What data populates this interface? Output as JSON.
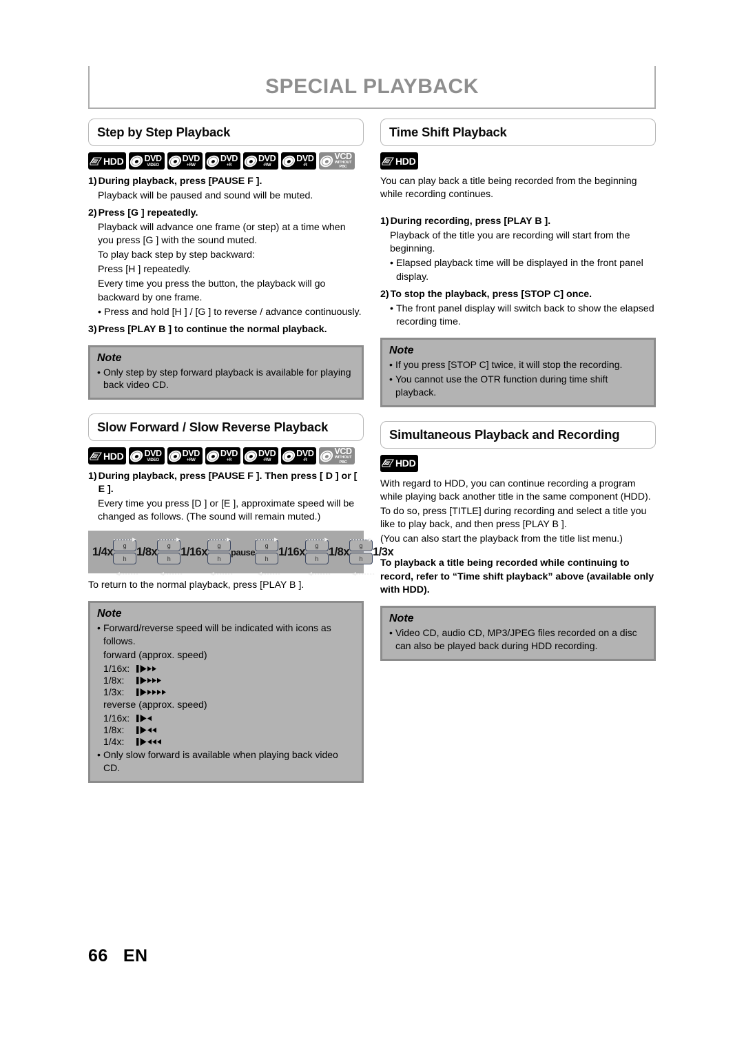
{
  "page": {
    "title": "SPECIAL PLAYBACK",
    "footer_number": "66",
    "footer_lang": "EN",
    "title_color": "#8e8e8e",
    "note_bg_color": "#b3b3b3",
    "note_border_color": "#8c8c8c",
    "diagram_bg_color": "#a8a8a8"
  },
  "icons": {
    "hdd": {
      "main": "HDD"
    },
    "dvd_video": {
      "main": "DVD",
      "sub": "VIDEO"
    },
    "dvd_plus_rw": {
      "main": "DVD",
      "sub": "+RW"
    },
    "dvd_plus_r": {
      "main": "DVD",
      "sub": "+R"
    },
    "dvd_minus_rw": {
      "main": "DVD",
      "sub": "-RW"
    },
    "dvd_minus_r": {
      "main": "DVD",
      "sub": "-R"
    },
    "vcd": {
      "main": "VCD",
      "sub1": "WITHOUT",
      "sub2": "PBC"
    }
  },
  "left": {
    "section1": {
      "heading": "Step by Step Playback",
      "step1": {
        "num": "1)",
        "text": "During playback, press [PAUSE F ]."
      },
      "step1_body": "Playback will be paused and sound will be muted.",
      "step2": {
        "num": "2)",
        "text": "Press [G  ] repeatedly."
      },
      "step2_body1": "Playback will advance one frame (or step) at a time when you press [G  ] with the sound muted.",
      "step2_body2": "To play back step by step backward:",
      "step2_body3": "Press [H  ] repeatedly.",
      "step2_body4": "Every time you press the button, the playback will go backward by one frame.",
      "step2_bullet": "Press and hold [H  ] / [G  ] to reverse / advance continuously.",
      "step3": {
        "num": "3)",
        "text": "Press [PLAY B ] to continue the normal playback."
      },
      "note": {
        "title": "Note",
        "bullets": [
          "Only step by step forward playback is available for playing back video CD."
        ]
      }
    },
    "section2": {
      "heading": "Slow Forward / Slow Reverse Playback",
      "step1": {
        "num": "1)",
        "text": "During playback, press [PAUSE F ]. Then press [ D  ] or [ E  ]."
      },
      "step1_body": "Every time you press [D  ] or [E  ], approximate speed will be changed as follows. (The sound will remain muted.)",
      "diagram": {
        "labels": [
          "1/4x",
          "1/8x",
          "1/16x",
          "pause",
          "1/16x",
          "1/8x",
          "1/3x"
        ],
        "key_top": "g",
        "key_bottom": "h"
      },
      "return_text": "To return to the normal playback, press [PLAY B ].",
      "note": {
        "title": "Note",
        "bullet1": "Forward/reverse speed will be indicated with icons as follows.",
        "forward_label": "forward (approx. speed)",
        "forward_rows": [
          {
            "speed": "1/16x:",
            "arrows": 2,
            "dir": "forward"
          },
          {
            "speed": "1/8x:",
            "arrows": 3,
            "dir": "forward"
          },
          {
            "speed": "1/3x:",
            "arrows": 4,
            "dir": "forward"
          }
        ],
        "reverse_label": "reverse (approx. speed)",
        "reverse_rows": [
          {
            "speed": "1/16x:",
            "arrows": 1,
            "dir": "reverse"
          },
          {
            "speed": "1/8x:",
            "arrows": 2,
            "dir": "reverse"
          },
          {
            "speed": "1/4x:",
            "arrows": 3,
            "dir": "reverse"
          }
        ],
        "bullet2": "Only slow forward is available when playing back video CD."
      }
    }
  },
  "right": {
    "section1": {
      "heading": "Time Shift Playback",
      "intro": "You can play back a title being recorded from the beginning while recording continues.",
      "step1": {
        "num": "1)",
        "text": "During recording, press [PLAY B ]."
      },
      "step1_body": "Playback of the title you are recording will start from the beginning.",
      "step1_bullet": "Elapsed playback time will be displayed in the front panel display.",
      "step2": {
        "num": "2)",
        "text": "To stop the playback, press [STOP C] once."
      },
      "step2_bullet": "The front panel display will switch back to show the elapsed recording time.",
      "note": {
        "title": "Note",
        "bullet1": "If you press [STOP C] twice, it will stop the recording.",
        "bullet2": "You cannot use the OTR function during time shift playback."
      }
    },
    "section2": {
      "heading": "Simultaneous Playback and Recording",
      "para1": "With regard to HDD, you can continue recording a program while playing back another title in the same component (HDD).",
      "para2": "To do so, press [TITLE] during recording and select a title you like to play back, and then press [PLAY B ].",
      "para3": "(You can also start the playback from the title list menu.)",
      "bold_para": "To playback a title being recorded while continuing to record, refer to “Time shift playback” above (available only with HDD).",
      "note": {
        "title": "Note",
        "bullets": [
          "Video CD, audio CD, MP3/JPEG files recorded on a disc can also be played back during HDD recording."
        ]
      }
    }
  }
}
